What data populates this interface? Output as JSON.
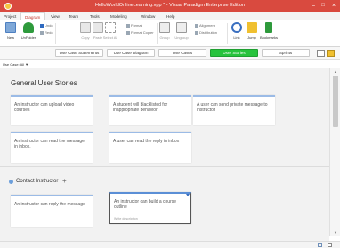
{
  "titlebar": {
    "title": "HelloWorldOnlineLearning.vpp * - Visual Paradigm Enterprise Edition",
    "minimize": "–",
    "maximize": "□",
    "close": "×"
  },
  "menu": {
    "items": [
      "Project",
      "Diagram",
      "View",
      "Team",
      "Tools",
      "Modeling",
      "Window",
      "Help"
    ],
    "active": "Diagram"
  },
  "ribbon": {
    "new": "New",
    "unfolder": "UnFolder",
    "undo": "Undo",
    "redo": "Redo",
    "copy": "Copy",
    "paste": "Paste",
    "select": "Select All",
    "format": "Format",
    "format_copier": "Format Copier",
    "group": "Group",
    "ungroup": "Ungroup",
    "alignment": "Alignment",
    "distribution": "Distribution",
    "link": "Link",
    "jump": "Jump",
    "bookmarks": "Bookmarks"
  },
  "tabs": {
    "items": [
      "Use Case Statements",
      "Use Case Diagram",
      "Use Cases",
      "User Stories",
      "Sprints"
    ],
    "active": "User Stories"
  },
  "filter": {
    "label": "Use Case:",
    "value": "All",
    "arrow": "▼"
  },
  "sections": {
    "general": {
      "title": "General User Stories",
      "stories": [
        "An instructor can upload video courses",
        "A student will blacklisted for inappropriate behavior",
        "A user can send private message to instructor",
        "An instructor can read the message in inbox.",
        "A user can read the reply in inbox"
      ]
    },
    "contact": {
      "title": "Contact Instructor",
      "plus": "+",
      "stories": [
        "An instructor can reply the message",
        "An instructor can build a course outline"
      ],
      "hint": "Write description"
    }
  },
  "colors": {
    "titlebar": "#d94a3f",
    "active_tab": "#27c33d",
    "story_border": "#9bbbe6"
  }
}
